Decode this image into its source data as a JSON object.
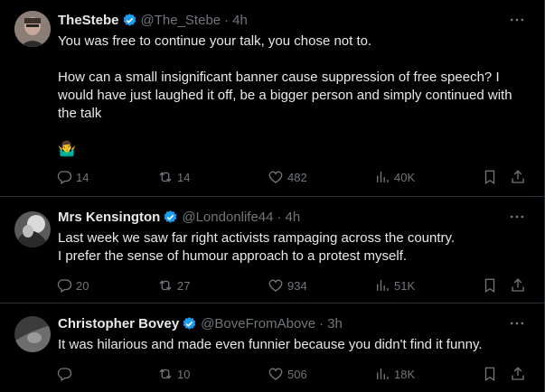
{
  "tweets": [
    {
      "name": "TheStebe",
      "handle": "@The_Stebe",
      "separator": "·",
      "time": "4h",
      "lines": [
        "You was free to continue your talk, you chose not to.",
        "How can a small insignificant banner cause suppression of free speech? I would have just laughed it off, be a bigger person and simply continued with the talk",
        "🤷‍♂️"
      ],
      "replies": "14",
      "reposts": "14",
      "likes": "482",
      "views": "40K"
    },
    {
      "name": "Mrs Kensington",
      "handle": "@Londonlife44",
      "separator": "·",
      "time": "4h",
      "lines": [
        "Last week we saw far right activists rampaging across the country.",
        "I prefer the sense of humour approach to a protest myself."
      ],
      "replies": "20",
      "reposts": "27",
      "likes": "934",
      "views": "51K"
    },
    {
      "name": "Christopher Bovey",
      "handle": "@BoveFromAbove",
      "separator": "·",
      "time": "3h",
      "lines": [
        "It was hilarious and made even funnier because you didn't find it funny."
      ],
      "replies": "",
      "reposts": "10",
      "likes": "506",
      "views": "18K"
    }
  ],
  "colors": {
    "verified": "#1d9bf0",
    "muted": "#71767b",
    "text": "#e7e9ea",
    "border": "#2f3336"
  },
  "icons": [
    "verified-badge-icon",
    "more-icon",
    "reply-icon",
    "repost-icon",
    "like-icon",
    "views-icon",
    "bookmark-icon",
    "share-icon"
  ]
}
